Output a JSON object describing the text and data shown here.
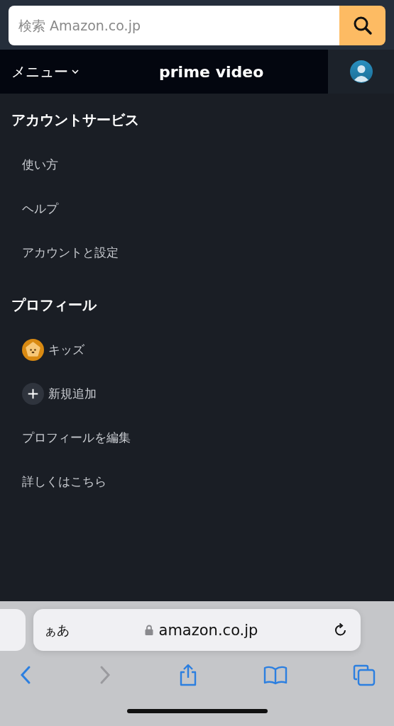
{
  "search": {
    "placeholder": "検索 Amazon.co.jp"
  },
  "header": {
    "menu_label": "メニュー",
    "logo": "prime video"
  },
  "sections": [
    {
      "title": "アカウントサービス",
      "items": [
        {
          "kind": "plain",
          "label": "使い方"
        },
        {
          "kind": "plain",
          "label": "ヘルプ"
        },
        {
          "kind": "plain",
          "label": "アカウントと設定"
        }
      ]
    },
    {
      "title": "プロフィール",
      "items": [
        {
          "kind": "kids",
          "label": "キッズ"
        },
        {
          "kind": "add",
          "label": "新規追加"
        },
        {
          "kind": "plain",
          "label": "プロフィールを編集"
        },
        {
          "kind": "plain",
          "label": "詳しくはこちら"
        }
      ]
    }
  ],
  "browser": {
    "text_size": "ぁあ",
    "address": "amazon.co.jp",
    "toolbar": [
      {
        "kind": "back",
        "disabled": false
      },
      {
        "kind": "forward",
        "disabled": true
      },
      {
        "kind": "share",
        "disabled": false
      },
      {
        "kind": "bookmarks",
        "disabled": false
      },
      {
        "kind": "tabs",
        "disabled": false
      }
    ]
  }
}
